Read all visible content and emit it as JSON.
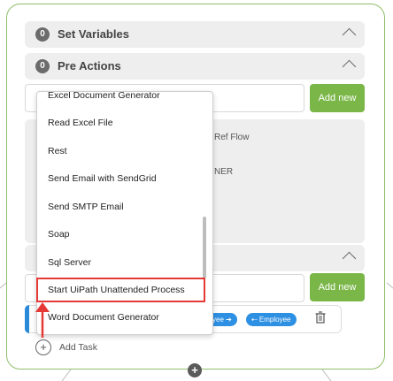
{
  "sections": {
    "set_variables": {
      "count": "0",
      "title": "Set Variables"
    },
    "pre_actions": {
      "count": "0",
      "title": "Pre Actions"
    }
  },
  "buttons": {
    "add_new_1": "Add new",
    "add_new_2": "Add new"
  },
  "panel_text": {
    "line1": "Ref Flow",
    "line2": "NER"
  },
  "dropdown": {
    "items": [
      "Excel Document Generator",
      "Read Excel File",
      "Rest",
      "Send Email with SendGrid",
      "Send SMTP Email",
      "Soap",
      "Sql Server",
      "Start UiPath Unattended Process",
      "Word Document Generator"
    ]
  },
  "task": {
    "pill1": "yee ➔",
    "pill2": "⇠ Employee"
  },
  "add_task": {
    "label": "Add Task"
  },
  "colors": {
    "accent_green": "#7ab648",
    "pill_blue": "#2e90e3",
    "highlight_red": "#e53935"
  }
}
